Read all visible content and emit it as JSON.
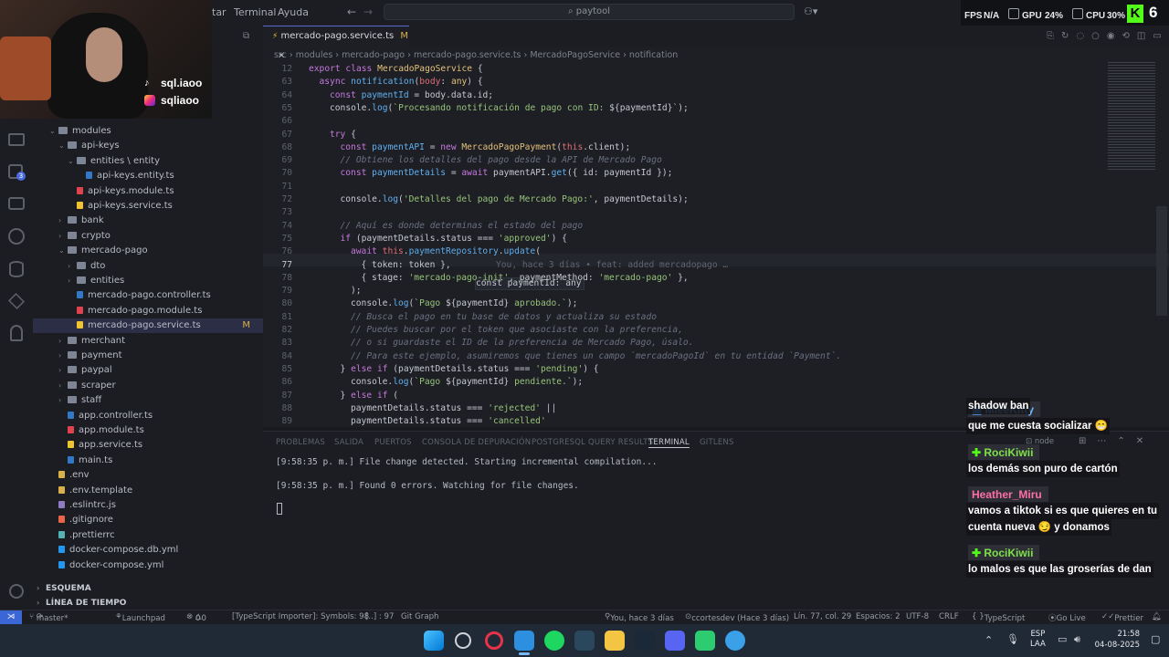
{
  "titlebar": {
    "menu_partial": "tar",
    "menu_terminal": "Terminal",
    "menu_help": "Ayuda",
    "search_value": "paytool"
  },
  "overlay": {
    "fps_label": "FPS",
    "fps_value": "N/A",
    "gpu_label": "GPU",
    "gpu_value": "24%",
    "cpu_label": "CPU",
    "cpu_value": "30%",
    "kick_count": "6"
  },
  "webcam": {
    "handle_1": "sql.iaoo",
    "handle_2": "sqliaoo"
  },
  "explorer": {
    "items": [
      {
        "label": "modules",
        "type": "folder-open",
        "indent": 1
      },
      {
        "label": "api-keys",
        "type": "folder-open",
        "indent": 2
      },
      {
        "label": "entities \\ entity",
        "type": "folder-open",
        "indent": 3
      },
      {
        "label": "api-keys.entity.ts",
        "type": "ts",
        "indent": 4
      },
      {
        "label": "api-keys.module.ts",
        "type": "module",
        "indent": 3
      },
      {
        "label": "api-keys.service.ts",
        "type": "service",
        "indent": 3
      },
      {
        "label": "bank",
        "type": "folder",
        "indent": 2
      },
      {
        "label": "crypto",
        "type": "folder",
        "indent": 2
      },
      {
        "label": "mercado-pago",
        "type": "folder-open",
        "indent": 2
      },
      {
        "label": "dto",
        "type": "folder",
        "indent": 3
      },
      {
        "label": "entities",
        "type": "folder",
        "indent": 3
      },
      {
        "label": "mercado-pago.controller.ts",
        "type": "ts",
        "indent": 3
      },
      {
        "label": "mercado-pago.module.ts",
        "type": "module",
        "indent": 3
      },
      {
        "label": "mercado-pago.service.ts",
        "type": "service",
        "indent": 3,
        "selected": true,
        "badge": "M"
      },
      {
        "label": "merchant",
        "type": "folder",
        "indent": 2
      },
      {
        "label": "payment",
        "type": "folder",
        "indent": 2
      },
      {
        "label": "paypal",
        "type": "folder",
        "indent": 2
      },
      {
        "label": "scraper",
        "type": "folder",
        "indent": 2
      },
      {
        "label": "staff",
        "type": "folder",
        "indent": 2
      },
      {
        "label": "app.controller.ts",
        "type": "ts",
        "indent": 2
      },
      {
        "label": "app.module.ts",
        "type": "module",
        "indent": 2
      },
      {
        "label": "app.service.ts",
        "type": "service",
        "indent": 2
      },
      {
        "label": "main.ts",
        "type": "ts",
        "indent": 2
      },
      {
        "label": ".env",
        "type": "env",
        "indent": 1
      },
      {
        "label": ".env.template",
        "type": "env",
        "indent": 1
      },
      {
        "label": ".eslintrc.js",
        "type": "eslint",
        "indent": 1
      },
      {
        "label": ".gitignore",
        "type": "git",
        "indent": 1
      },
      {
        "label": ".prettierrc",
        "type": "prettier",
        "indent": 1
      },
      {
        "label": "docker-compose.db.yml",
        "type": "docker",
        "indent": 1
      },
      {
        "label": "docker-compose.yml",
        "type": "docker",
        "indent": 1
      }
    ],
    "section_outline": "ESQUEMA",
    "section_timeline": "LÍNEA DE TIEMPO"
  },
  "editor": {
    "tab_label": "mercado-pago.service.ts",
    "tab_badge": "M",
    "breadcrumb": [
      "src",
      "modules",
      "mercado-pago",
      "mercado-pago.service.ts",
      "MercadoPagoService",
      "notification"
    ],
    "hover_tooltip": "const paymentId: any",
    "blame": "You, hace 3 días • feat: added mercadopago …"
  },
  "panel": {
    "tabs": [
      "PROBLEMAS",
      "SALIDA",
      "PUERTOS",
      "CONSOLA DE DEPURACIÓN",
      "POSTGRESQL QUERY RESULTS",
      "TERMINAL",
      "GITLENS"
    ],
    "active_tab": "TERMINAL",
    "terminal_lines": [
      "[9:58:35 p. m.] File change detected. Starting incremental compilation...",
      "[9:58:35 p. m.] Found 0 errors. Watching for file changes."
    ],
    "shell_label": "node"
  },
  "statusbar": {
    "branch": "master*",
    "launchpad": "Launchpad",
    "errors": "0",
    "warnings": "0",
    "ts_importer": "[TypeScript Importer]: Symbols: 98",
    "selection": "[..] : 97",
    "git_graph": "Git Graph",
    "blame": "You, hace 3 días",
    "author": "ccortesdev (Hace 3 días)",
    "position": "Lín. 77, col. 29",
    "spaces": "Espacios: 2",
    "encoding": "UTF-8",
    "eol": "CRLF",
    "language": "TypeScript",
    "go_live": "Go Live",
    "prettier": "Prettier"
  },
  "chat": [
    {
      "user": "MleeKitty",
      "color": "#6fb7ff",
      "badge": "mod",
      "message": "que me cuesta socializar 😁"
    },
    {
      "user": "RociKiwii",
      "color": "#7ee04a",
      "badge": "plus",
      "message": "los demás son puro de cartón"
    },
    {
      "user": "Heather_Miru",
      "color": "#ff6fa6",
      "badge": "",
      "message": "vamos a tiktok si es que quieres en tu",
      "message2": "cuenta nueva 😏 y donamos"
    },
    {
      "user": "RociKiwii",
      "color": "#7ee04a",
      "badge": "plus",
      "message": "lo malos es que las groserías de dan",
      "message2": "shadow ban"
    }
  ],
  "taskbar": {
    "lang": "ESP",
    "lang2": "LAA",
    "time": "21:58",
    "date": "04-08-2025"
  }
}
